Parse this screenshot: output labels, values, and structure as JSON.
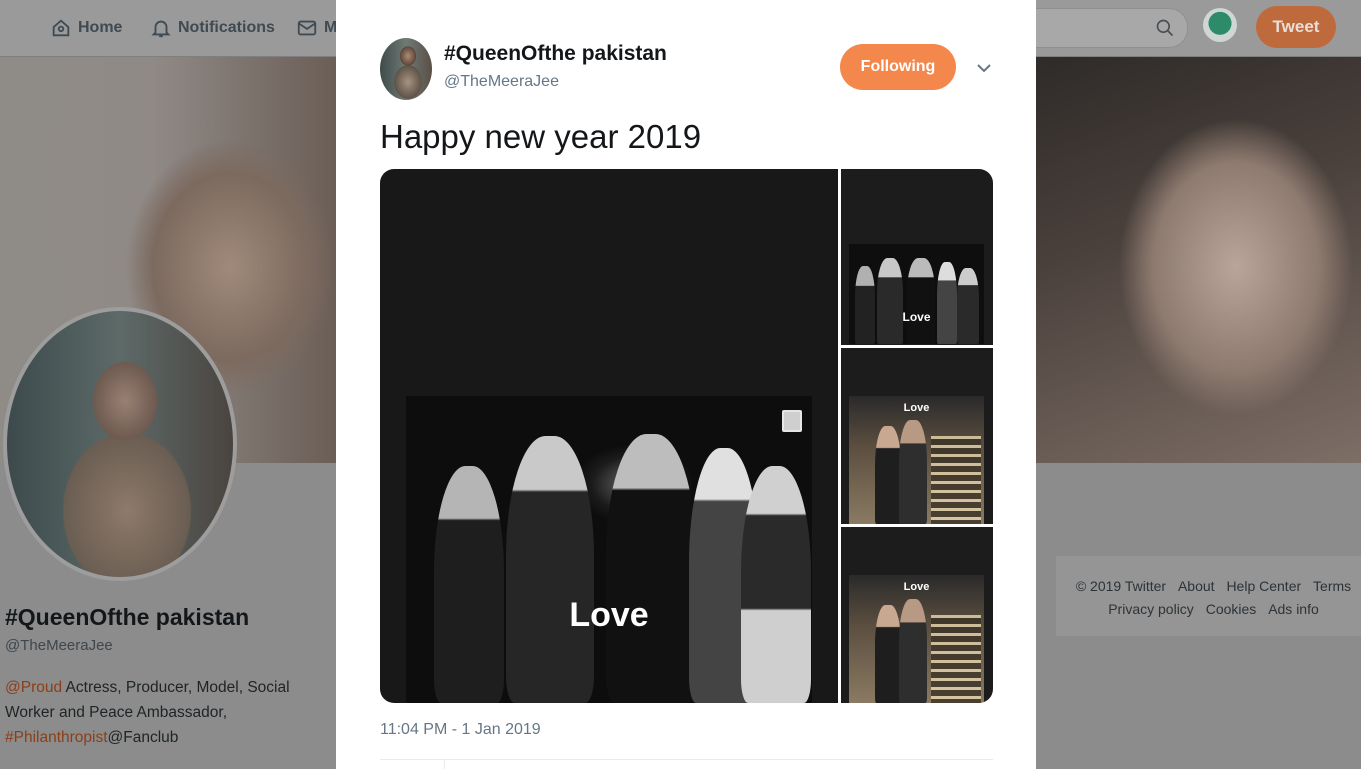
{
  "nav": {
    "home": "Home",
    "notifications": "Notifications",
    "messages": "M"
  },
  "search": {
    "placeholder": "r"
  },
  "tweet_button": "Tweet",
  "profile": {
    "name": "#QueenOfthe pakistan",
    "handle": "@TheMeeraJee",
    "bio_mention1": "@Proud",
    "bio_text1": " Actress, Producer, Model, Social Worker and Peace Ambassador, ",
    "bio_mention2": "#Philanthropist",
    "bio_text2": "@Fanclub"
  },
  "footer": {
    "links": [
      "© 2019 Twitter",
      "About",
      "Help Center",
      "Terms",
      "Privacy policy",
      "Cookies",
      "Ads info"
    ]
  },
  "tweet": {
    "author_name": "#QueenOfthe pakistan",
    "author_handle": "@TheMeeraJee",
    "follow_label": "Following",
    "text": "Happy new year 2019",
    "photo_caption_main": "Love",
    "photo_caption_thumb1": "Love",
    "photo_caption_thumb2": "Love",
    "photo_caption_thumb3": "Love",
    "timestamp": "11:04 PM - 1 Jan 2019"
  },
  "colors": {
    "accent": "#f4874b",
    "text_primary": "#14171a",
    "text_secondary": "#657786"
  }
}
